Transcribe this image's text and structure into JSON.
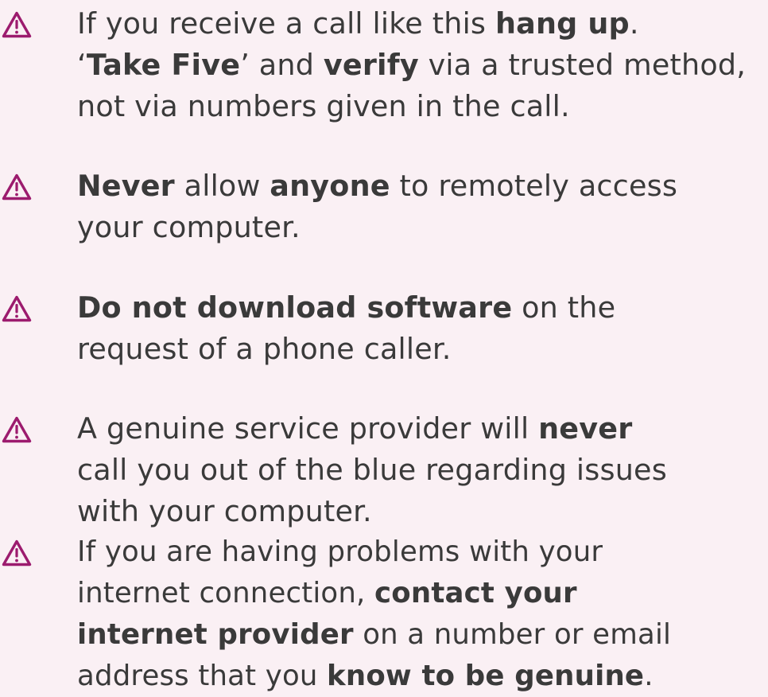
{
  "colors": {
    "background": "#faf0f4",
    "text": "#3a3a3a",
    "accent": "#9c1b6e"
  },
  "icon": "warning-triangle-icon",
  "tips": [
    {
      "lines": [
        [
          {
            "text": "If you receive a call like this ",
            "bold": false
          },
          {
            "text": "hang up",
            "bold": true
          },
          {
            "text": ".",
            "bold": false
          }
        ],
        [
          {
            "text": "‘",
            "bold": false
          },
          {
            "text": "Take Five",
            "bold": true
          },
          {
            "text": "’ and ",
            "bold": false
          },
          {
            "text": "verify",
            "bold": true
          },
          {
            "text": " via a trusted method,",
            "bold": false
          }
        ],
        [
          {
            "text": "not via numbers given in the call.",
            "bold": false
          }
        ]
      ]
    },
    {
      "lines": [
        [
          {
            "text": "Never",
            "bold": true
          },
          {
            "text": " allow ",
            "bold": false
          },
          {
            "text": "anyone",
            "bold": true
          },
          {
            "text": " to remotely access",
            "bold": false
          }
        ],
        [
          {
            "text": "your computer.",
            "bold": false
          }
        ]
      ]
    },
    {
      "lines": [
        [
          {
            "text": "Do not download software",
            "bold": true
          },
          {
            "text": " on the",
            "bold": false
          }
        ],
        [
          {
            "text": "request of a phone caller.",
            "bold": false
          }
        ]
      ]
    },
    {
      "lines": [
        [
          {
            "text": "A genuine service provider will ",
            "bold": false
          },
          {
            "text": "never",
            "bold": true
          }
        ],
        [
          {
            "text": "call you out of the blue regarding issues",
            "bold": false
          }
        ],
        [
          {
            "text": "with your computer.",
            "bold": false
          }
        ]
      ]
    },
    {
      "lines": [
        [
          {
            "text": "If you are having problems with your",
            "bold": false
          }
        ],
        [
          {
            "text": "internet connection, ",
            "bold": false
          },
          {
            "text": "contact your",
            "bold": true
          }
        ],
        [
          {
            "text": "internet provider",
            "bold": true
          },
          {
            "text": " on a number or email",
            "bold": false
          }
        ],
        [
          {
            "text": "address that you ",
            "bold": false
          },
          {
            "text": "know to be genuine",
            "bold": true
          },
          {
            "text": ".",
            "bold": false
          }
        ]
      ]
    }
  ]
}
